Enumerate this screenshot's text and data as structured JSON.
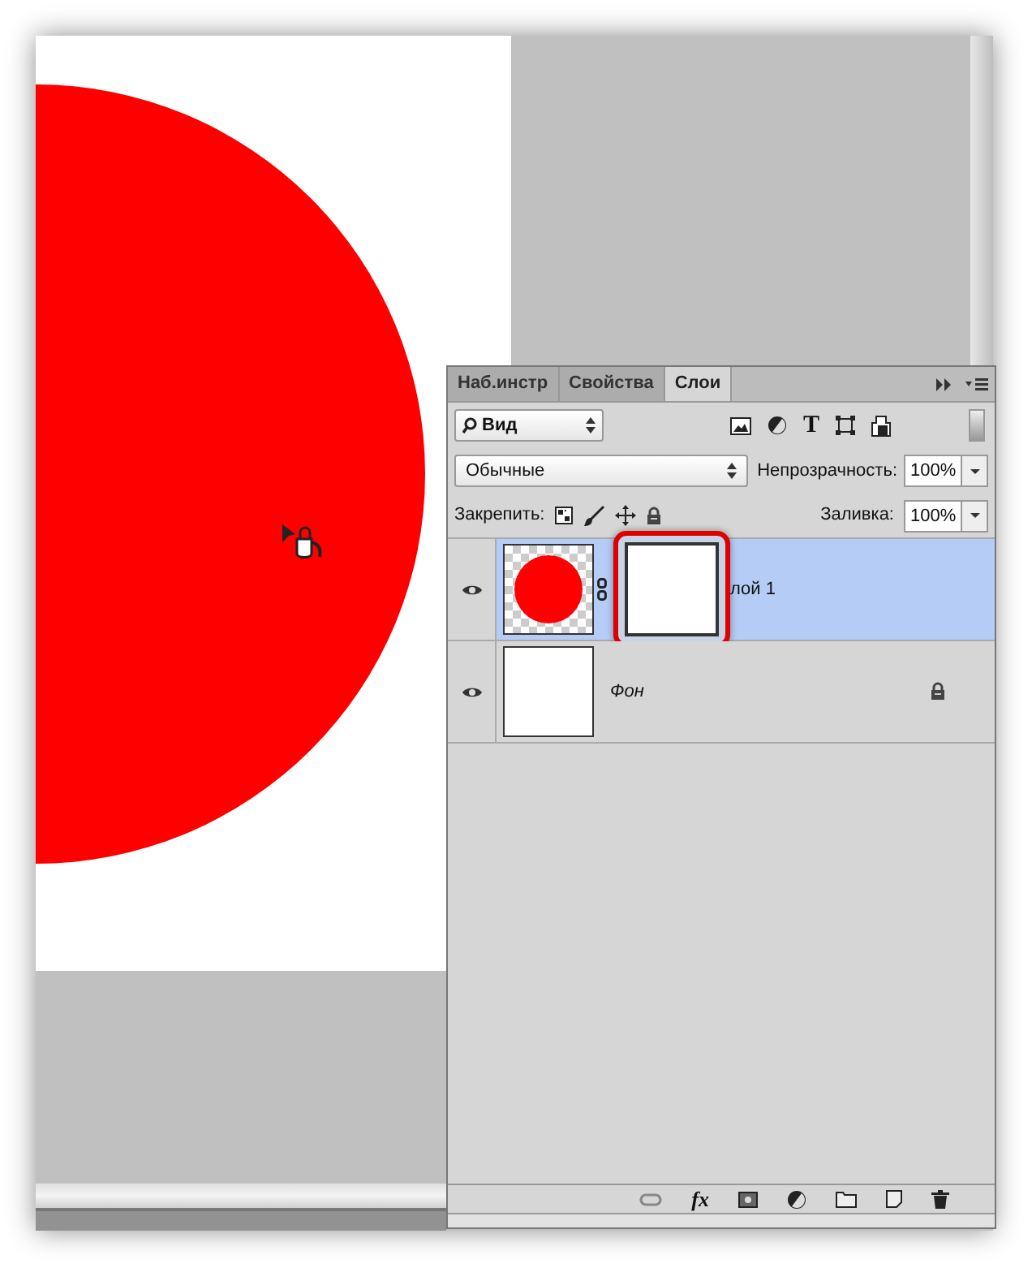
{
  "tabs": [
    {
      "label": "Наб.инстр",
      "selected": false
    },
    {
      "label": "Свойства",
      "selected": false
    },
    {
      "label": "Слои",
      "selected": true
    }
  ],
  "filter": {
    "label": "Вид"
  },
  "filter_tools": {
    "type_glyph": "T"
  },
  "bottom_tools": {
    "effects_glyph": "fx"
  },
  "blend_mode": {
    "value": "Обычные"
  },
  "opacity": {
    "label": "Непрозрачность:",
    "value": "100%"
  },
  "lock": {
    "label": "Закрепить:"
  },
  "fill": {
    "label": "Заливка:",
    "value": "100%"
  },
  "layers": [
    {
      "name": "лой 1",
      "selected": true,
      "visible": true,
      "kind": "shape",
      "locked": false,
      "mask": true
    },
    {
      "name": "Фон",
      "selected": false,
      "visible": true,
      "kind": "background",
      "locked": true,
      "mask": false
    }
  ]
}
